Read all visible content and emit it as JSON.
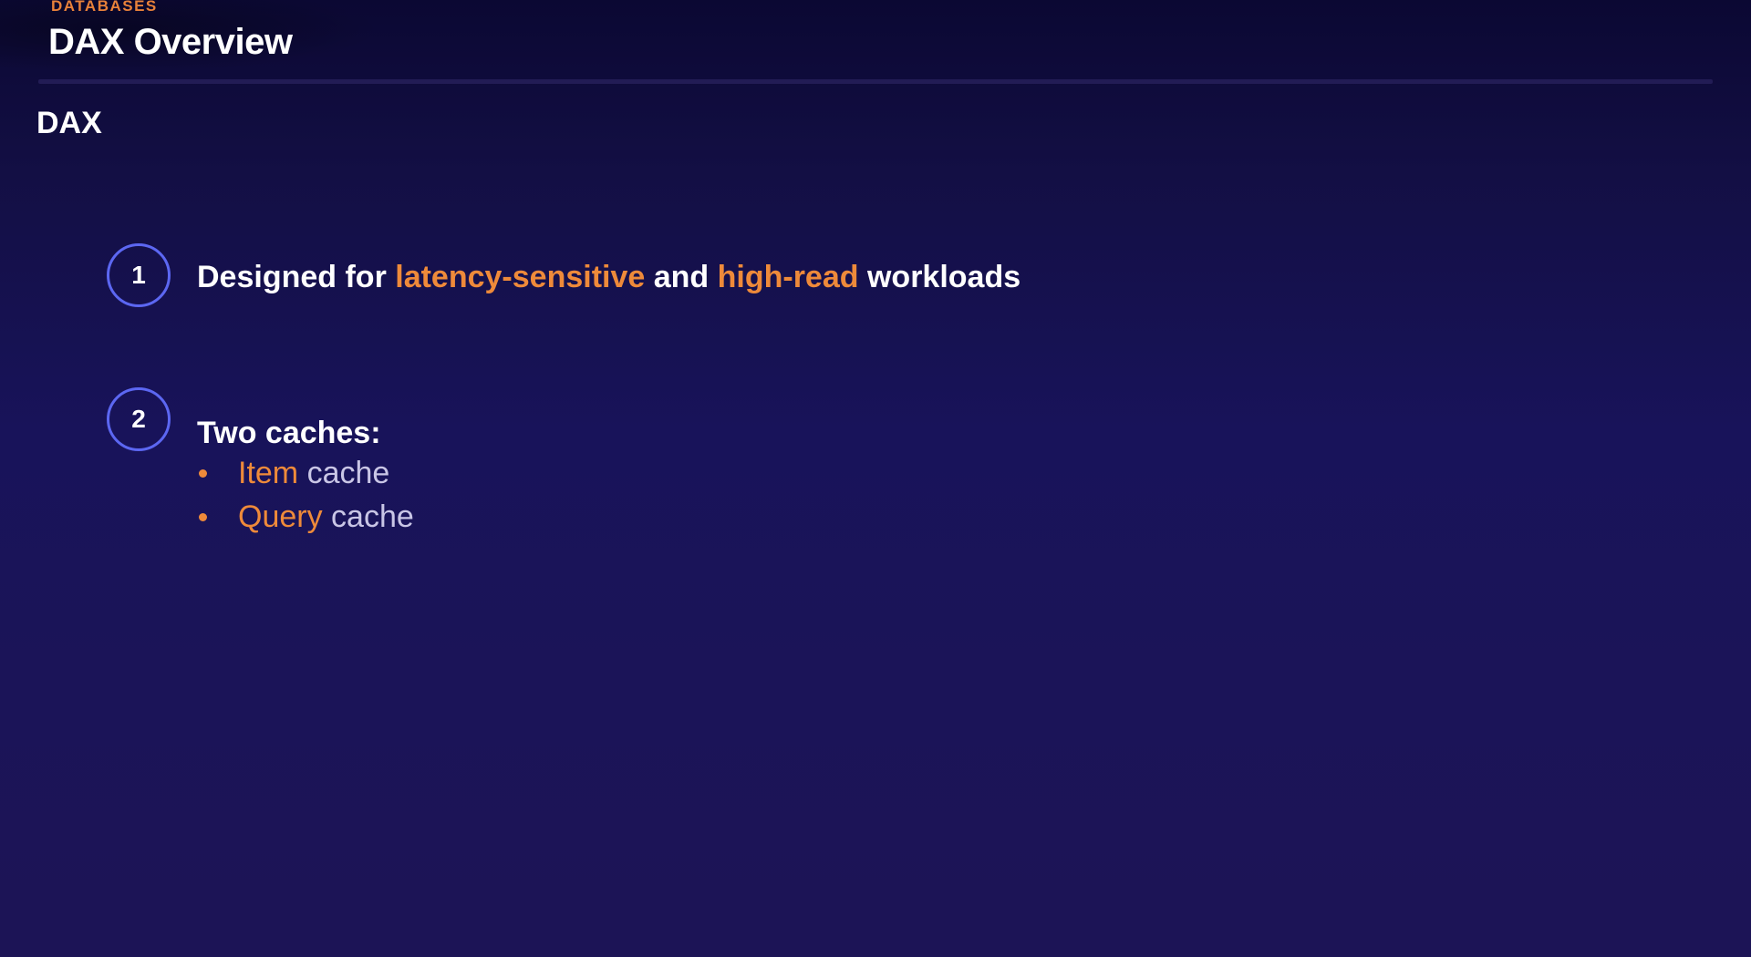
{
  "header": {
    "kicker": "DATABASES",
    "title": "DAX Overview"
  },
  "section": {
    "label": "DAX"
  },
  "points": [
    {
      "number": "1",
      "parts": [
        {
          "text": "Designed for ",
          "highlight": false
        },
        {
          "text": "latency-sensitive",
          "highlight": true
        },
        {
          "text": " and ",
          "highlight": false
        },
        {
          "text": "high-read",
          "highlight": true
        },
        {
          "text": " workloads",
          "highlight": false
        }
      ]
    },
    {
      "number": "2",
      "heading": "Two caches:",
      "bullets": [
        {
          "highlight": "Item",
          "rest": " cache"
        },
        {
          "highlight": "Query",
          "rest": " cache"
        }
      ]
    }
  ],
  "colors": {
    "accent": "#ee8a3a",
    "circle": "#5c67f2",
    "background": "#1b1458"
  }
}
